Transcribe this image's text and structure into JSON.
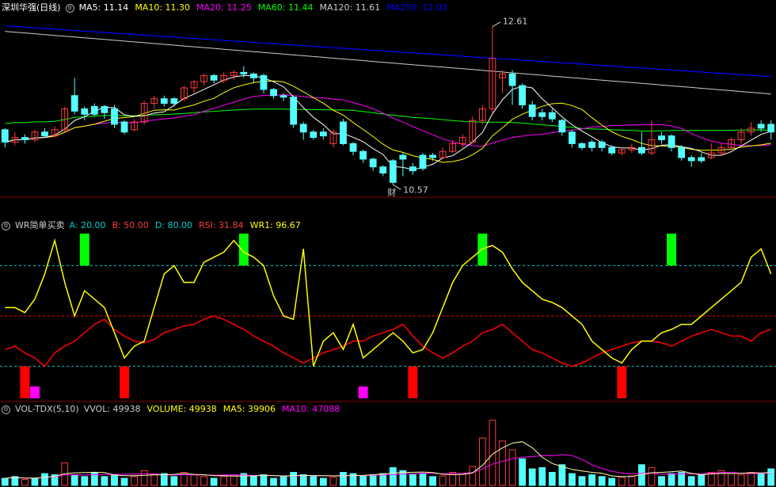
{
  "colors": {
    "background": "#000000",
    "up": "#ff3b3b",
    "down": "#54ffff",
    "panel_border": "#8b0000",
    "ma5": "#ffffff",
    "ma10": "#ffff00",
    "ma20": "#ff00ff",
    "ma60": "#00ff00",
    "ma120": "#cccccc",
    "ma250": "#0000ff",
    "wr": "#ffff00",
    "rsi": "#ff0000",
    "signal_buy": "#00ff00",
    "signal_sell": "#ff0000",
    "signal_mid": "#ff00ff",
    "level_line": "#00cccc",
    "mid_line": "#ff0000"
  },
  "price_panel": {
    "title": "深圳华强(日线)",
    "indicators": [
      {
        "label": "MA5: 11.14",
        "color": "#ffffff"
      },
      {
        "label": "MA10: 11.30",
        "color": "#ffff00"
      },
      {
        "label": "MA20: 11.25",
        "color": "#ff00ff"
      },
      {
        "label": "MA60: 11.44",
        "color": "#00ff00"
      },
      {
        "label": "MA120: 11.61",
        "color": "#cccccc"
      },
      {
        "label": "MA250: 12.03",
        "color": "#0000ff"
      }
    ],
    "high_label": "12.61",
    "low_label": "10.57",
    "event_marker": "财"
  },
  "wr_panel": {
    "title": "WR简单买卖",
    "indicators": [
      {
        "label": "A: 20.00",
        "color": "#00cccc"
      },
      {
        "label": "B: 50.00",
        "color": "#ff3b3b"
      },
      {
        "label": "D: 80.00",
        "color": "#00cccc"
      },
      {
        "label": "RSI: 31.84",
        "color": "#ff3b3b"
      },
      {
        "label": "WR1: 96.67",
        "color": "#ffff00"
      }
    ]
  },
  "vol_panel": {
    "title": "VOL-TDX(5,10)",
    "indicators": [
      {
        "label": "VVOL: 49938",
        "color": "#cccccc"
      },
      {
        "label": "VOLUME: 49938",
        "color": "#ffff00"
      },
      {
        "label": "MA5: 39906",
        "color": "#ffff00"
      },
      {
        "label": "MA10: 47088",
        "color": "#ff00ff"
      }
    ]
  },
  "chart_data": {
    "type": "candlestick",
    "y_range": [
      10.45,
      12.75
    ],
    "candles": [
      [
        11.28,
        11.12,
        11.3,
        11.05,
        "d"
      ],
      [
        11.12,
        11.18,
        11.25,
        11.08,
        "u"
      ],
      [
        11.18,
        11.15,
        11.22,
        11.1,
        "d"
      ],
      [
        11.15,
        11.25,
        11.28,
        11.12,
        "u"
      ],
      [
        11.25,
        11.2,
        11.3,
        11.18,
        "d"
      ],
      [
        11.2,
        11.28,
        11.32,
        11.18,
        "u"
      ],
      [
        11.28,
        11.55,
        11.58,
        11.25,
        "u"
      ],
      [
        11.52,
        11.72,
        11.95,
        11.48,
        "d"
      ],
      [
        11.55,
        11.48,
        11.58,
        11.4,
        "d"
      ],
      [
        11.48,
        11.58,
        11.62,
        11.45,
        "d"
      ],
      [
        11.58,
        11.5,
        11.6,
        11.42,
        "d"
      ],
      [
        11.35,
        11.55,
        11.6,
        11.3,
        "d"
      ],
      [
        11.38,
        11.25,
        11.4,
        11.22,
        "d"
      ],
      [
        11.28,
        11.38,
        11.42,
        11.26,
        "u"
      ],
      [
        11.38,
        11.62,
        11.65,
        11.35,
        "u"
      ],
      [
        11.62,
        11.68,
        11.72,
        11.55,
        "u"
      ],
      [
        11.68,
        11.62,
        11.72,
        11.58,
        "d"
      ],
      [
        11.62,
        11.68,
        11.7,
        11.58,
        "d"
      ],
      [
        11.68,
        11.82,
        11.85,
        11.65,
        "u"
      ],
      [
        11.82,
        11.9,
        11.92,
        11.75,
        "u"
      ],
      [
        11.9,
        11.98,
        12.0,
        11.85,
        "u"
      ],
      [
        11.98,
        11.92,
        12.0,
        11.88,
        "d"
      ],
      [
        11.92,
        11.98,
        12.02,
        11.88,
        "u"
      ],
      [
        11.98,
        12.02,
        12.05,
        11.92,
        "u"
      ],
      [
        12.02,
        12.0,
        12.1,
        11.95,
        "d"
      ],
      [
        12.0,
        11.95,
        12.02,
        11.88,
        "d"
      ],
      [
        11.98,
        11.8,
        12.0,
        11.75,
        "d"
      ],
      [
        11.8,
        11.72,
        11.82,
        11.68,
        "d"
      ],
      [
        11.72,
        11.7,
        11.75,
        11.65,
        "d"
      ],
      [
        11.7,
        11.35,
        11.72,
        11.3,
        "d"
      ],
      [
        11.35,
        11.25,
        11.38,
        11.15,
        "d"
      ],
      [
        11.25,
        11.18,
        11.28,
        11.15,
        "d"
      ],
      [
        11.2,
        11.25,
        11.3,
        11.15,
        "d"
      ],
      [
        11.25,
        11.1,
        11.28,
        11.05,
        "u"
      ],
      [
        11.1,
        11.38,
        11.42,
        11.08,
        "d"
      ],
      [
        11.1,
        11.0,
        11.12,
        10.95,
        "d"
      ],
      [
        11.0,
        10.9,
        11.02,
        10.85,
        "d"
      ],
      [
        10.9,
        10.8,
        10.92,
        10.75,
        "d"
      ],
      [
        10.8,
        10.72,
        10.82,
        10.68,
        "d"
      ],
      [
        10.88,
        10.6,
        10.9,
        10.57,
        "d"
      ],
      [
        10.9,
        10.95,
        10.98,
        10.68,
        "d"
      ],
      [
        10.8,
        10.75,
        10.85,
        10.7,
        "d"
      ],
      [
        10.78,
        10.95,
        10.98,
        10.75,
        "d"
      ],
      [
        10.95,
        10.92,
        10.98,
        10.88,
        "d"
      ],
      [
        10.92,
        11.0,
        11.05,
        10.9,
        "u"
      ],
      [
        11.0,
        11.1,
        11.15,
        10.98,
        "u"
      ],
      [
        11.1,
        11.18,
        11.22,
        11.05,
        "u"
      ],
      [
        11.12,
        11.4,
        11.45,
        11.1,
        "u"
      ],
      [
        11.4,
        11.55,
        11.6,
        11.35,
        "u"
      ],
      [
        11.55,
        12.2,
        12.61,
        11.5,
        "u"
      ],
      [
        11.95,
        12.0,
        12.05,
        11.75,
        "u"
      ],
      [
        12.0,
        11.85,
        12.05,
        11.6,
        "d"
      ],
      [
        11.85,
        11.6,
        11.88,
        11.55,
        "d"
      ],
      [
        11.6,
        11.45,
        11.65,
        11.4,
        "d"
      ],
      [
        11.45,
        11.5,
        11.55,
        11.4,
        "d"
      ],
      [
        11.5,
        11.42,
        11.55,
        11.38,
        "d"
      ],
      [
        11.4,
        11.25,
        11.42,
        11.2,
        "d"
      ],
      [
        11.25,
        11.1,
        11.28,
        11.05,
        "d"
      ],
      [
        11.1,
        11.05,
        11.12,
        11.02,
        "d"
      ],
      [
        11.05,
        11.12,
        11.15,
        11.0,
        "d"
      ],
      [
        11.12,
        11.05,
        11.15,
        11.0,
        "d"
      ],
      [
        11.05,
        10.98,
        11.08,
        10.95,
        "d"
      ],
      [
        10.98,
        11.02,
        11.05,
        10.95,
        "u"
      ],
      [
        11.02,
        11.05,
        11.1,
        10.98,
        "u"
      ],
      [
        11.05,
        10.98,
        11.25,
        10.95,
        "d"
      ],
      [
        10.98,
        11.15,
        11.4,
        10.95,
        "u"
      ],
      [
        11.15,
        11.2,
        11.25,
        11.1,
        "d"
      ],
      [
        11.2,
        11.05,
        11.22,
        11.0,
        "d"
      ],
      [
        11.05,
        10.92,
        11.08,
        10.88,
        "d"
      ],
      [
        10.92,
        10.88,
        10.95,
        10.8,
        "d"
      ],
      [
        10.88,
        10.92,
        10.98,
        10.85,
        "d"
      ],
      [
        10.92,
        10.98,
        11.1,
        10.9,
        "u"
      ],
      [
        10.98,
        11.05,
        11.1,
        10.95,
        "u"
      ],
      [
        11.05,
        11.15,
        11.18,
        11.02,
        "u"
      ],
      [
        11.15,
        11.25,
        11.3,
        11.1,
        "u"
      ],
      [
        11.25,
        11.3,
        11.38,
        11.2,
        "u"
      ],
      [
        11.3,
        11.35,
        11.4,
        11.25,
        "d"
      ],
      [
        11.35,
        11.25,
        11.4,
        11.15,
        "d"
      ]
    ],
    "wr_series": [
      55,
      55,
      52,
      60,
      75,
      95,
      70,
      50,
      65,
      60,
      55,
      40,
      25,
      32,
      35,
      55,
      75,
      80,
      70,
      70,
      82,
      85,
      88,
      95,
      88,
      85,
      80,
      62,
      50,
      48,
      90,
      20,
      35,
      40,
      30,
      45,
      25,
      30,
      35,
      40,
      35,
      28,
      30,
      40,
      55,
      70,
      80,
      85,
      90,
      92,
      88,
      78,
      70,
      65,
      60,
      58,
      55,
      50,
      45,
      35,
      30,
      25,
      22,
      30,
      35,
      35,
      40,
      42,
      45,
      45,
      50,
      55,
      60,
      65,
      70,
      85,
      90,
      75
    ],
    "rsi_series": [
      70,
      68,
      72,
      75,
      80,
      72,
      68,
      65,
      60,
      55,
      52,
      58,
      62,
      65,
      66,
      64,
      60,
      58,
      56,
      55,
      52,
      50,
      52,
      55,
      58,
      62,
      65,
      68,
      72,
      75,
      78,
      75,
      72,
      70,
      68,
      65,
      65,
      62,
      60,
      58,
      55,
      62,
      68,
      72,
      75,
      72,
      68,
      65,
      60,
      58,
      55,
      60,
      65,
      70,
      72,
      75,
      78,
      80,
      78,
      75,
      72,
      70,
      68,
      66,
      65,
      65,
      66,
      68,
      65,
      62,
      60,
      58,
      60,
      62,
      62,
      65,
      60,
      58
    ],
    "wr_buy_signals": [
      8,
      24,
      48,
      67
    ],
    "wr_sell_signals": [
      2,
      12,
      41,
      62
    ],
    "wr_mid_signals": [
      3,
      36
    ],
    "volume": [
      [
        12,
        "d"
      ],
      [
        15,
        "d"
      ],
      [
        10,
        "u"
      ],
      [
        12,
        "d"
      ],
      [
        20,
        "d"
      ],
      [
        18,
        "d"
      ],
      [
        38,
        "u"
      ],
      [
        18,
        "d"
      ],
      [
        15,
        "d"
      ],
      [
        22,
        "d"
      ],
      [
        15,
        "d"
      ],
      [
        18,
        "d"
      ],
      [
        12,
        "d"
      ],
      [
        15,
        "u"
      ],
      [
        25,
        "u"
      ],
      [
        18,
        "u"
      ],
      [
        20,
        "d"
      ],
      [
        15,
        "d"
      ],
      [
        22,
        "u"
      ],
      [
        18,
        "u"
      ],
      [
        15,
        "u"
      ],
      [
        12,
        "d"
      ],
      [
        15,
        "u"
      ],
      [
        18,
        "u"
      ],
      [
        20,
        "d"
      ],
      [
        15,
        "d"
      ],
      [
        18,
        "d"
      ],
      [
        12,
        "d"
      ],
      [
        15,
        "d"
      ],
      [
        22,
        "d"
      ],
      [
        18,
        "d"
      ],
      [
        15,
        "d"
      ],
      [
        12,
        "d"
      ],
      [
        14,
        "u"
      ],
      [
        22,
        "d"
      ],
      [
        20,
        "d"
      ],
      [
        16,
        "d"
      ],
      [
        18,
        "d"
      ],
      [
        20,
        "d"
      ],
      [
        30,
        "d"
      ],
      [
        25,
        "d"
      ],
      [
        18,
        "d"
      ],
      [
        20,
        "d"
      ],
      [
        15,
        "d"
      ],
      [
        16,
        "u"
      ],
      [
        22,
        "u"
      ],
      [
        20,
        "u"
      ],
      [
        32,
        "u"
      ],
      [
        80,
        "u"
      ],
      [
        110,
        "u"
      ],
      [
        75,
        "u"
      ],
      [
        60,
        "u"
      ],
      [
        45,
        "d"
      ],
      [
        28,
        "d"
      ],
      [
        30,
        "d"
      ],
      [
        22,
        "d"
      ],
      [
        35,
        "d"
      ],
      [
        20,
        "d"
      ],
      [
        15,
        "d"
      ],
      [
        18,
        "d"
      ],
      [
        15,
        "d"
      ],
      [
        12,
        "d"
      ],
      [
        14,
        "u"
      ],
      [
        16,
        "u"
      ],
      [
        35,
        "d"
      ],
      [
        30,
        "u"
      ],
      [
        15,
        "d"
      ],
      [
        20,
        "d"
      ],
      [
        22,
        "d"
      ],
      [
        15,
        "d"
      ],
      [
        18,
        "d"
      ],
      [
        22,
        "u"
      ],
      [
        25,
        "u"
      ],
      [
        20,
        "u"
      ],
      [
        18,
        "u"
      ],
      [
        22,
        "u"
      ],
      [
        20,
        "d"
      ],
      [
        28,
        "d"
      ]
    ],
    "vol_max": 115
  }
}
